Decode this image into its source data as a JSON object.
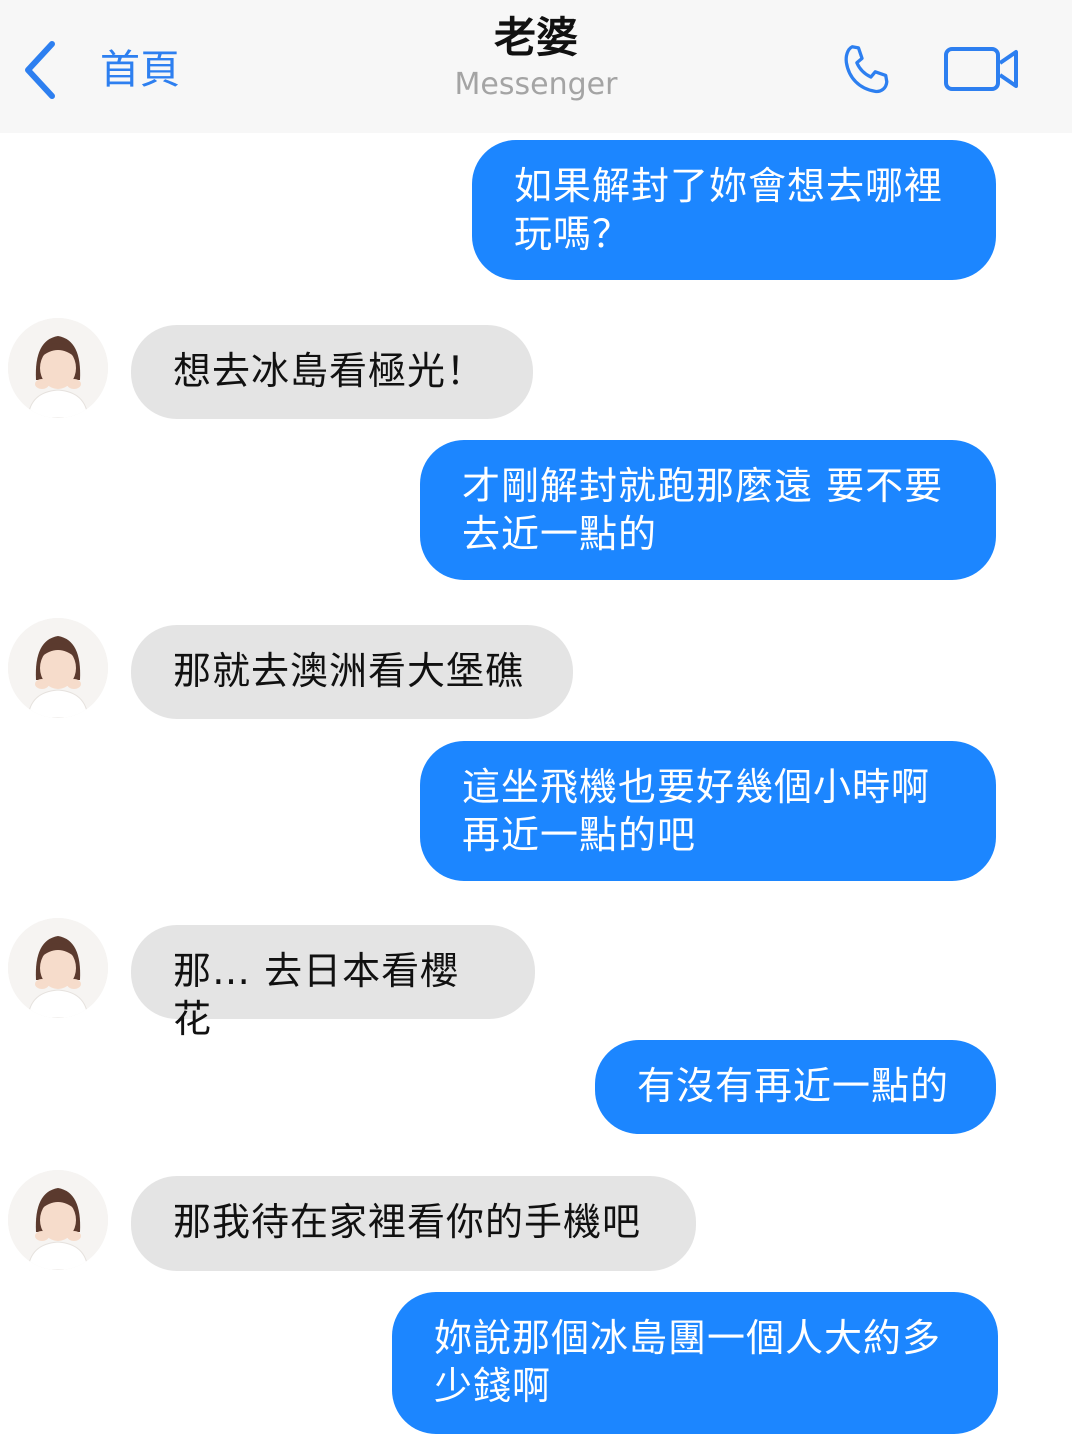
{
  "header": {
    "back_label": "首頁",
    "contact_name": "老婆",
    "app_name": "Messenger",
    "icons": [
      "chevron-left-icon",
      "phone-icon",
      "video-call-icon"
    ]
  },
  "colors": {
    "accent": "#1c86ff",
    "link": "#2d7ff0",
    "incoming_bubble": "#e4e4e4",
    "header_bg": "#f7f7f7"
  },
  "messages": [
    {
      "sender": "me",
      "text": "如果解封了妳會想去哪裡\n玩嗎？"
    },
    {
      "sender": "wife",
      "text": "想去冰島看極光！"
    },
    {
      "sender": "me",
      "text": "才剛解封就跑那麼遠 要不要\n去近一點的"
    },
    {
      "sender": "wife",
      "text": "那就去澳洲看大堡礁"
    },
    {
      "sender": "me",
      "text": "這坐飛機也要好幾個小時啊\n再近一點的吧"
    },
    {
      "sender": "wife",
      "text": "那… 去日本看櫻花"
    },
    {
      "sender": "me",
      "text": "有沒有再近一點的"
    },
    {
      "sender": "wife",
      "text": "那我待在家裡看你的手機吧"
    },
    {
      "sender": "me",
      "text": "妳說那個冰島團一個人大約多\n少錢啊"
    }
  ]
}
